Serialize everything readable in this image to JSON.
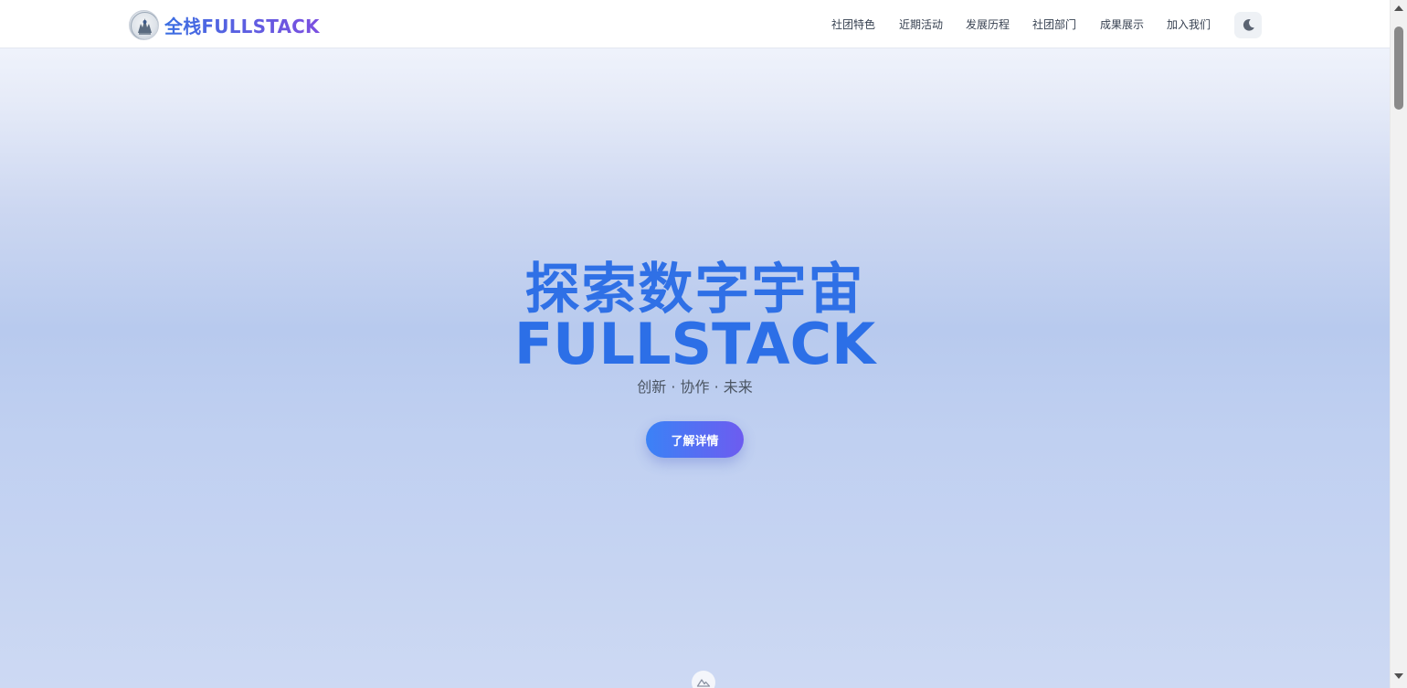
{
  "header": {
    "brand_name": "全栈FULLSTACK",
    "logo_icon": "club-logo-icon",
    "nav": [
      {
        "label": "社团特色"
      },
      {
        "label": "近期活动"
      },
      {
        "label": "发展历程"
      },
      {
        "label": "社团部门"
      },
      {
        "label": "成果展示"
      },
      {
        "label": "加入我们"
      }
    ],
    "theme_toggle_icon": "moon-icon"
  },
  "hero": {
    "title_line1": "探索数字宇宙",
    "title_line2": "FULLSTACK",
    "subtitle": "创新 · 协作 · 未来",
    "cta_label": "了解详情",
    "scroll_icon": "mountain-icon"
  },
  "colors": {
    "accent": "#2f70e6",
    "cta_start": "#3b82f6",
    "cta_end": "#6d5cf0",
    "brand_gradient_start": "#3b6fe2",
    "brand_gradient_end": "#7b4fe0"
  }
}
